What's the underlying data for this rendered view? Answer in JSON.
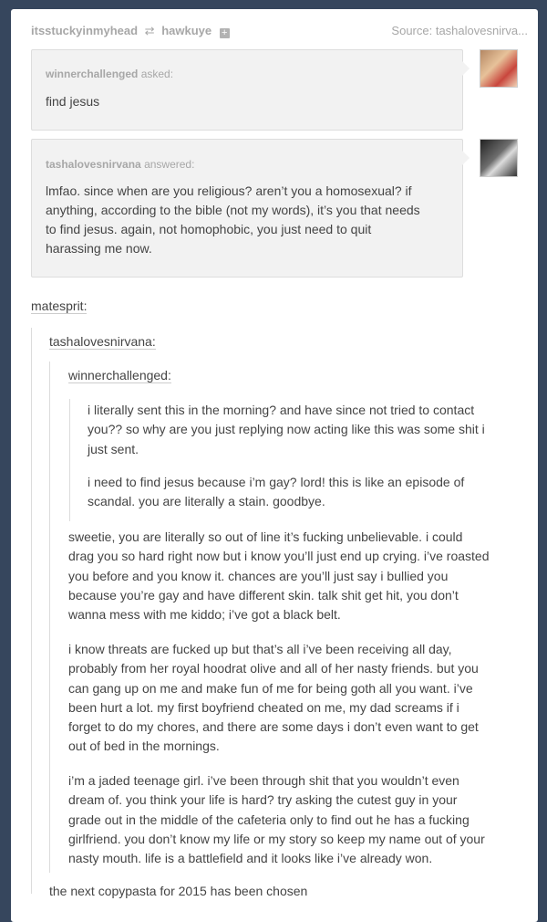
{
  "header": {
    "reblogger": "itsstuckyinmyhead",
    "reblog_icon": "reblog-icon",
    "original_poster": "hawkuye",
    "follow_icon": "plus-icon",
    "source": "Source: tashalovesnirva..."
  },
  "ask": {
    "asker": "winnerchallenged",
    "asked_label": "asked:",
    "question": "find jesus"
  },
  "answer": {
    "answerer": "tashalovesnirvana",
    "answered_label": "answered:",
    "lines": [
      "lmfao. since when are you religious? aren’t you a homosexual? if",
      "anything, according to the bible (not my words), it’s you that needs",
      "to find jesus. again, not homophobic, you just need to quit",
      "harassing me now."
    ]
  },
  "thread": {
    "matesprit": "matesprit:",
    "tasha": "tashalovesnirvana:",
    "winner": "winnerchallenged:",
    "winner_p1": [
      "i literally sent this in the morning? and have since not tried to contact",
      "you?? so why are you just replying now acting like this was some shit i",
      "just sent."
    ],
    "winner_p2": [
      "i need to find jesus because i’m gay? lord! this is like an episode of",
      "scandal. you are literally a stain. goodbye."
    ],
    "tasha_p1": [
      "sweetie, you are literally so out of line it’s fucking unbelievable. i could",
      "drag you so hard right now but i know you’ll just end up crying. i’ve roasted",
      "you before and you know it. chances are you’ll just say i bullied you",
      "because you’re gay and have different skin. talk shit get hit, you don’t",
      "wanna mess with me kiddo; i’ve got a black belt."
    ],
    "tasha_p2": [
      "i know threats are fucked up but that’s all i’ve been receiving all day,",
      "probably from her royal hoodrat olive and all of her nasty friends. but you",
      "can gang up on me and make fun of me for being goth all you want. i’ve",
      "been hurt a lot. my first boyfriend cheated on me, my dad screams if i",
      "forget to do my chores, and there are some days i don’t even want to get",
      "out of bed in the mornings."
    ],
    "tasha_p3": [
      "i’m a jaded teenage girl. i’ve been through shit that you wouldn’t even",
      "dream of. you think your life is hard? try asking the cutest guy in your",
      "grade out in the middle of the cafeteria only to find out he has a fucking",
      "girlfriend. you don’t know my life or my story so keep my name out of your",
      "nasty mouth. life is a battlefield and it looks like i’ve already won."
    ],
    "final": "the next copypasta for 2015 has been chosen"
  }
}
